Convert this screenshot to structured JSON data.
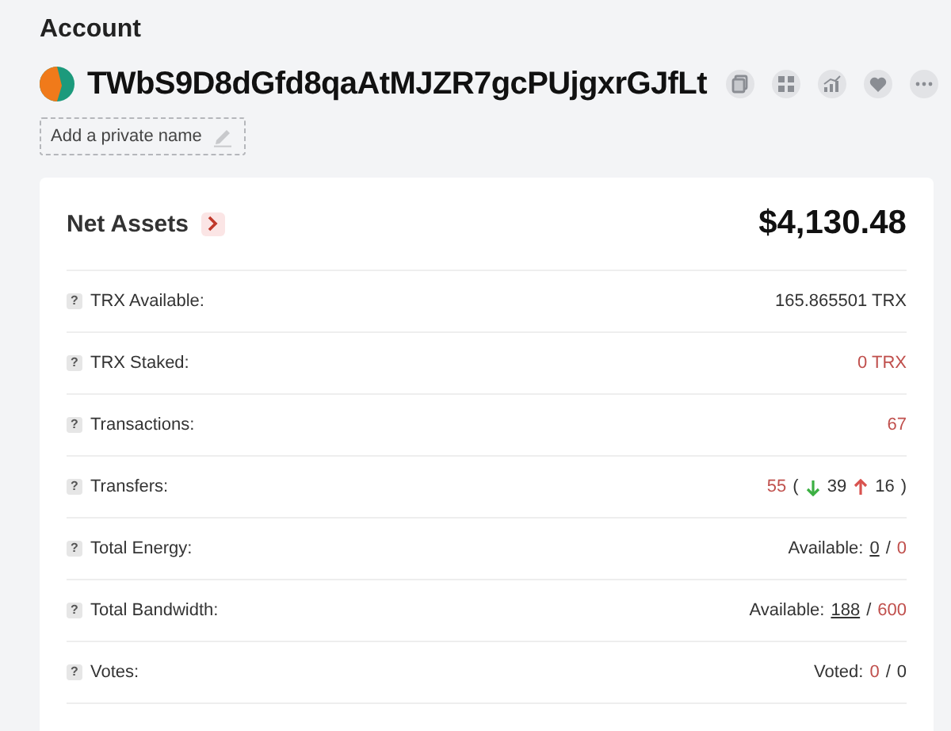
{
  "heading": "Account",
  "address": "TWbS9D8dGfd8qaAtMJZR7gcPUjgxrGJfLt",
  "actions": [
    {
      "kind": "copy"
    },
    {
      "kind": "qr"
    },
    {
      "kind": "chart"
    },
    {
      "kind": "heart"
    },
    {
      "kind": "more"
    }
  ],
  "private_name": {
    "placeholder": "Add a private name"
  },
  "net_assets": {
    "label": "Net Assets",
    "value": "$4,130.48"
  },
  "rows": [
    {
      "help": "?",
      "label": "TRX Available:",
      "parts": [
        {
          "kind": "plain",
          "text": "165.865501 TRX"
        }
      ]
    },
    {
      "help": "?",
      "label": "TRX Staked:",
      "parts": [
        {
          "kind": "red",
          "text": "0 TRX"
        }
      ]
    },
    {
      "help": "?",
      "label": "Transactions:",
      "parts": [
        {
          "kind": "red",
          "text": "67"
        }
      ]
    },
    {
      "help": "?",
      "label": "Transfers:",
      "parts": [
        {
          "kind": "red",
          "text": "55"
        },
        {
          "kind": "plain",
          "text": "("
        },
        {
          "kind": "down",
          "text": "39"
        },
        {
          "kind": "up",
          "text": "16"
        },
        {
          "kind": "plain",
          "text": ")"
        }
      ]
    },
    {
      "help": "?",
      "label": "Total Energy:",
      "parts": [
        {
          "kind": "plain",
          "text": "Available:"
        },
        {
          "kind": "underline",
          "text": "0"
        },
        {
          "kind": "plain",
          "text": "/"
        },
        {
          "kind": "red",
          "text": "0"
        }
      ]
    },
    {
      "help": "?",
      "label": "Total Bandwidth:",
      "parts": [
        {
          "kind": "plain",
          "text": "Available:"
        },
        {
          "kind": "underline",
          "text": "188"
        },
        {
          "kind": "plain",
          "text": "/"
        },
        {
          "kind": "red",
          "text": "600"
        }
      ]
    },
    {
      "help": "?",
      "label": "Votes:",
      "parts": [
        {
          "kind": "plain",
          "text": "Voted:"
        },
        {
          "kind": "red",
          "text": "0"
        },
        {
          "kind": "plain",
          "text": "/"
        },
        {
          "kind": "plain",
          "text": "0"
        }
      ]
    }
  ]
}
